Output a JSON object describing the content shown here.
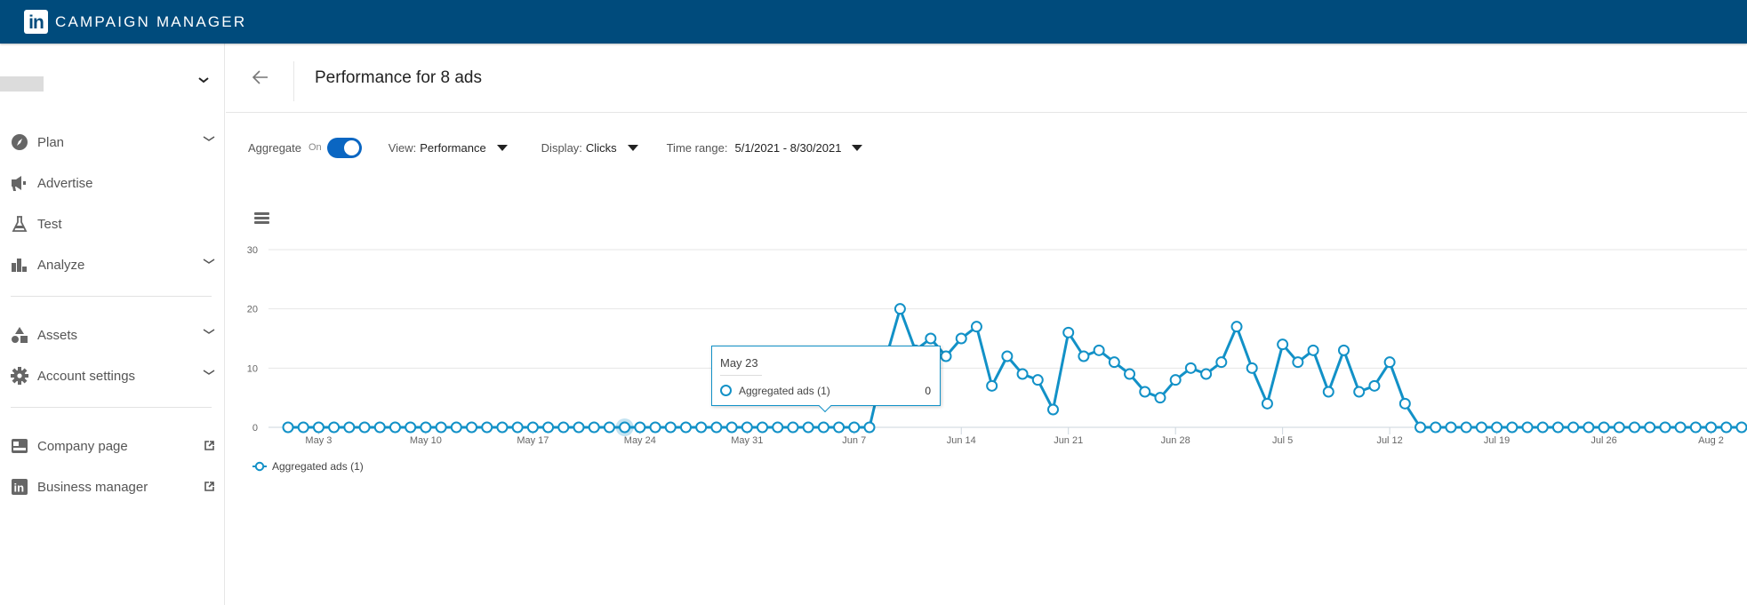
{
  "topbar": {
    "logo": "in",
    "title": "CAMPAIGN MANAGER",
    "brand_color": "#004b7c"
  },
  "sidebar": {
    "items": [
      {
        "label": "Plan",
        "icon": "compass-icon",
        "expandable": true
      },
      {
        "label": "Advertise",
        "icon": "megaphone-icon",
        "expandable": false
      },
      {
        "label": "Test",
        "icon": "flask-icon",
        "expandable": false
      },
      {
        "label": "Analyze",
        "icon": "bar-chart-icon",
        "expandable": true
      },
      {
        "label": "Assets",
        "icon": "shapes-icon",
        "expandable": true
      },
      {
        "label": "Account settings",
        "icon": "gear-icon",
        "expandable": true
      },
      {
        "label": "Company page",
        "icon": "company-page-icon",
        "external": true
      },
      {
        "label": "Business manager",
        "icon": "linkedin-icon",
        "external": true
      }
    ]
  },
  "header": {
    "title": "Performance for 8 ads"
  },
  "controls": {
    "aggregate_label": "Aggregate",
    "aggregate_state": "On",
    "aggregate_on": true,
    "view_label": "View:",
    "view_value": "Performance",
    "display_label": "Display:",
    "display_value": "Clicks",
    "time_label": "Time range:",
    "time_value": "5/1/2021 - 8/30/2021"
  },
  "tooltip": {
    "date": "May 23",
    "series": "Aggregated ads (1)",
    "value": "0"
  },
  "legend": {
    "label": "Aggregated ads (1)"
  },
  "chart_data": {
    "type": "line",
    "title": "",
    "xlabel": "",
    "ylabel": "",
    "ylim": [
      0,
      30
    ],
    "yticks": [
      0,
      10,
      20,
      30
    ],
    "grid": true,
    "legend_position": "bottom-left",
    "start_date": "May 1",
    "xtick_labels": [
      "May 3",
      "May 10",
      "May 17",
      "May 24",
      "May 31",
      "Jun 7",
      "Jun 14",
      "Jun 21",
      "Jun 28",
      "Jul 5",
      "Jul 12",
      "Jul 19",
      "Jul 26",
      "Aug 2"
    ],
    "xtick_day_index": [
      2,
      9,
      16,
      23,
      30,
      37,
      44,
      51,
      58,
      65,
      72,
      79,
      86,
      93
    ],
    "highlighted_index": 22,
    "series": [
      {
        "name": "Aggregated ads (1)",
        "color": "#1291c7",
        "values": [
          0,
          0,
          0,
          0,
          0,
          0,
          0,
          0,
          0,
          0,
          0,
          0,
          0,
          0,
          0,
          0,
          0,
          0,
          0,
          0,
          0,
          0,
          0,
          0,
          0,
          0,
          0,
          0,
          0,
          0,
          0,
          0,
          0,
          0,
          0,
          0,
          0,
          0,
          0,
          11,
          20,
          13,
          15,
          12,
          15,
          17,
          7,
          12,
          9,
          8,
          3,
          16,
          12,
          13,
          11,
          9,
          6,
          5,
          8,
          10,
          9,
          11,
          17,
          10,
          4,
          14,
          11,
          13,
          6,
          13,
          6,
          7,
          11,
          4,
          0,
          0,
          0,
          0,
          0,
          0,
          0,
          0,
          0,
          0,
          0,
          0,
          0,
          0,
          0,
          0,
          0,
          0,
          0,
          0,
          0,
          0
        ]
      }
    ]
  }
}
